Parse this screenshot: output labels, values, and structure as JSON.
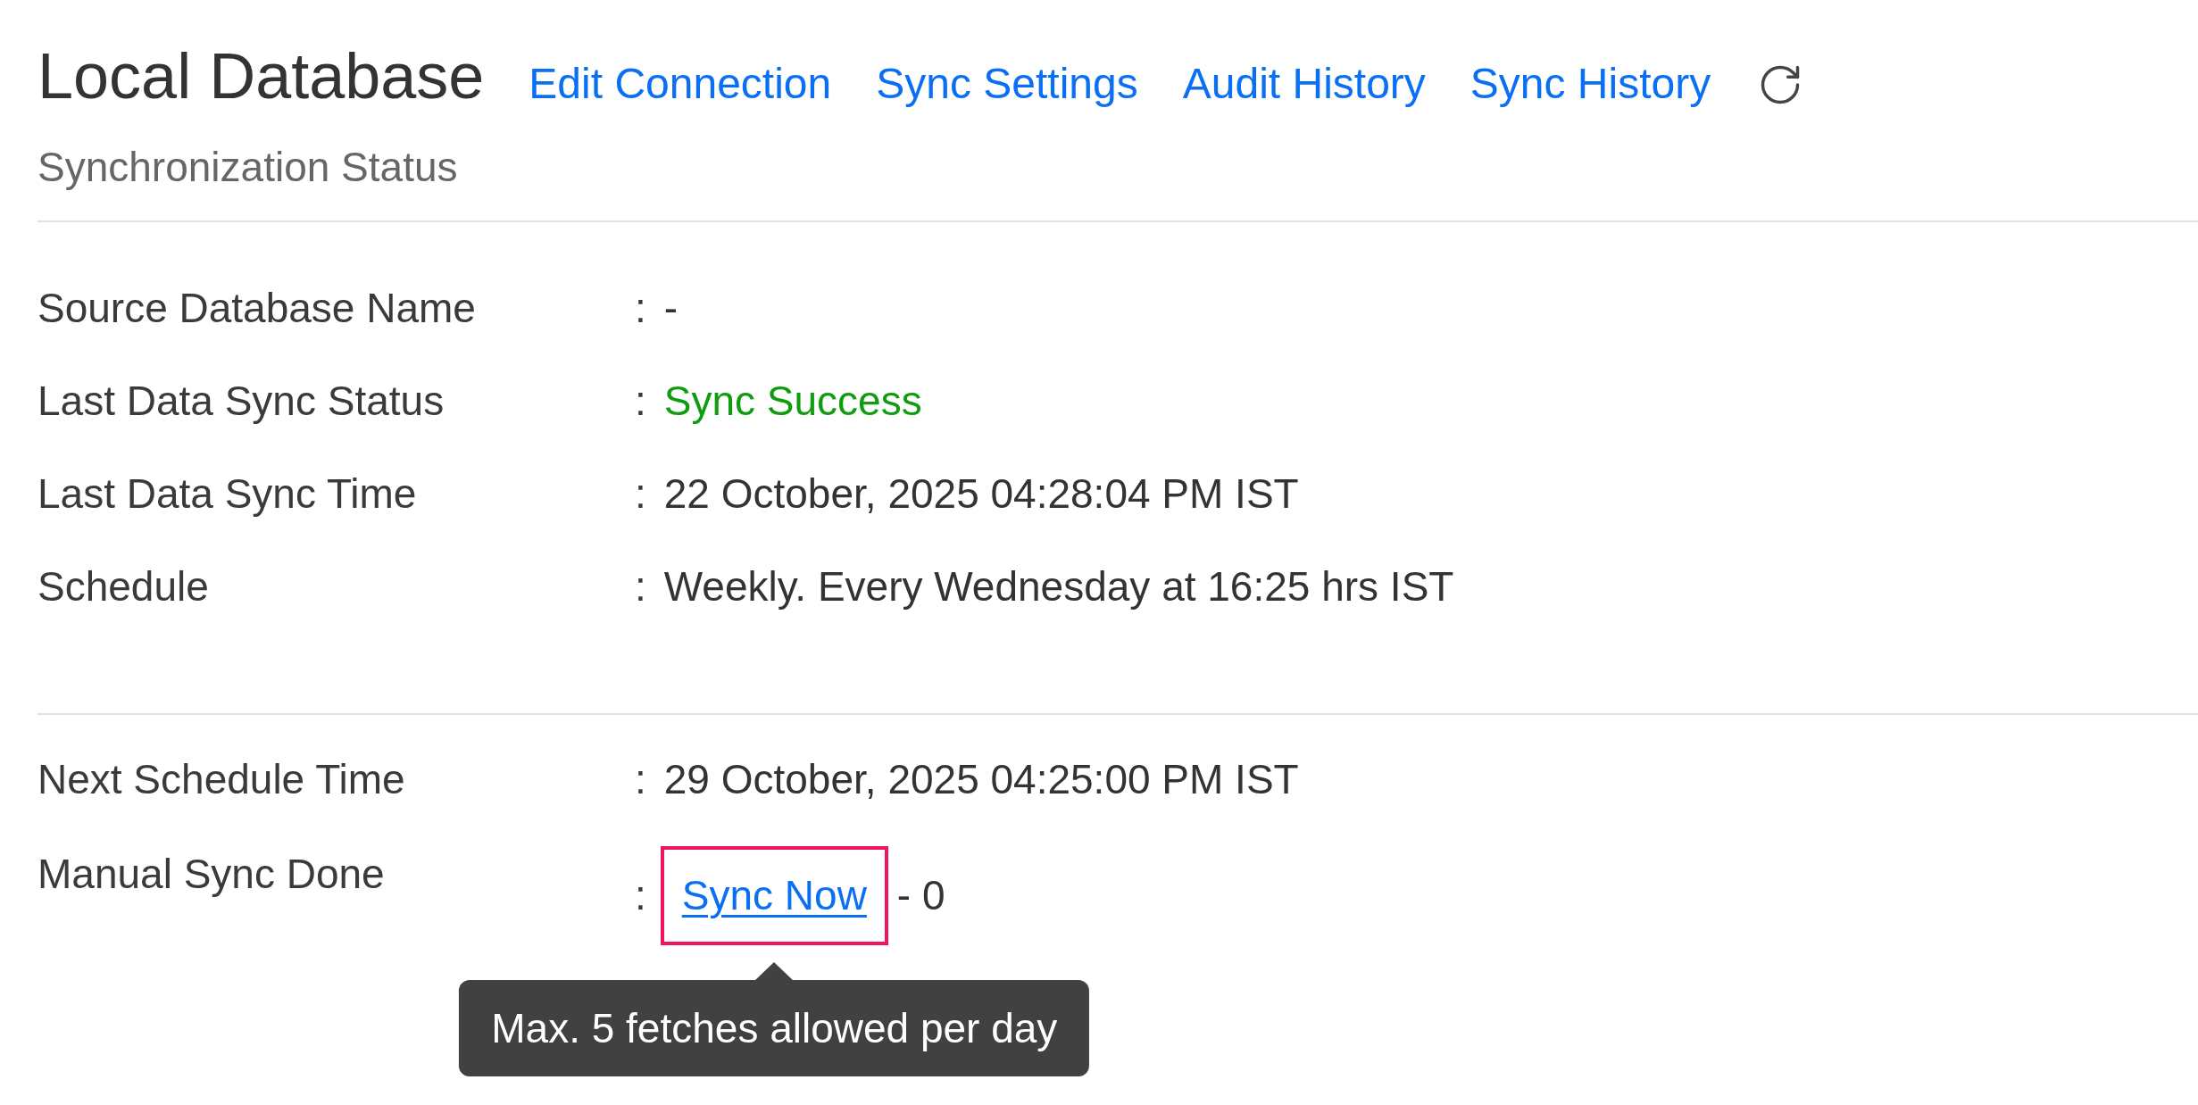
{
  "header": {
    "title": "Local Database",
    "links": [
      {
        "label": "Edit Connection"
      },
      {
        "label": "Sync Settings"
      },
      {
        "label": "Audit History"
      },
      {
        "label": "Sync History"
      }
    ],
    "subtitle": "Synchronization Status"
  },
  "sync_details": [
    {
      "kind": "text",
      "label": "Source Database Name",
      "separator": ":",
      "value": "-"
    },
    {
      "kind": "status",
      "label": "Last Data Sync Status",
      "separator": ":",
      "value": "Sync Success"
    },
    {
      "kind": "text",
      "label": "Last Data Sync Time",
      "separator": ":",
      "value": "22 October, 2025 04:28:04 PM IST"
    },
    {
      "kind": "text",
      "label": "Schedule",
      "separator": ":",
      "value": "Weekly. Every Wednesday at 16:25 hrs IST"
    }
  ],
  "schedule_details": [
    {
      "kind": "text",
      "label": "Next Schedule Time",
      "separator": ":",
      "value": "29 October, 2025 04:25:00 PM IST"
    },
    {
      "kind": "action",
      "label": "Manual Sync Done",
      "separator": ":",
      "action": "Sync Now",
      "value": "- 0",
      "highlighted": true
    }
  ],
  "tooltip": {
    "text": "Max. 5 fetches allowed per day"
  }
}
